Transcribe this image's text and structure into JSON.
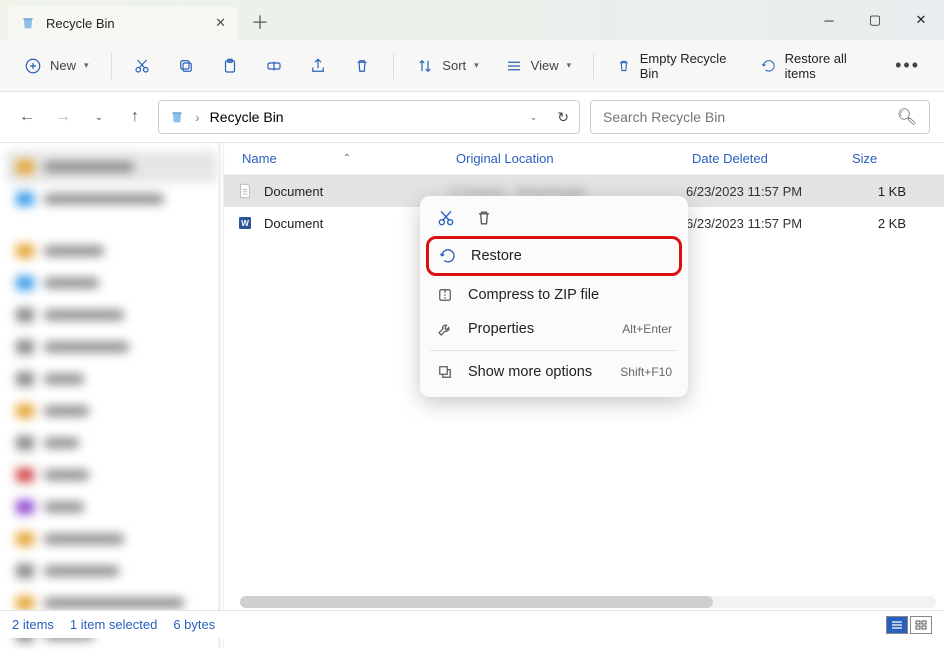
{
  "window": {
    "tab_title": "Recycle Bin"
  },
  "toolbar": {
    "new": "New",
    "sort": "Sort",
    "view": "View",
    "empty": "Empty Recycle Bin",
    "restore_all": "Restore all items"
  },
  "address": {
    "path": "Recycle Bin"
  },
  "search": {
    "placeholder": "Search Recycle Bin"
  },
  "columns": {
    "name": "Name",
    "original": "Original Location",
    "deleted": "Date Deleted",
    "size": "Size"
  },
  "files": [
    {
      "name": "Document",
      "original": "",
      "deleted": "6/23/2023 11:57 PM",
      "size": "1 KB",
      "type": "txt"
    },
    {
      "name": "Document",
      "original": "",
      "deleted": "6/23/2023 11:57 PM",
      "size": "2 KB",
      "type": "docx"
    }
  ],
  "context_menu": {
    "restore": "Restore",
    "compress": "Compress to ZIP file",
    "properties": "Properties",
    "properties_shortcut": "Alt+Enter",
    "more": "Show more options",
    "more_shortcut": "Shift+F10"
  },
  "status": {
    "count": "2 items",
    "selection": "1 item selected",
    "bytes": "6 bytes"
  }
}
